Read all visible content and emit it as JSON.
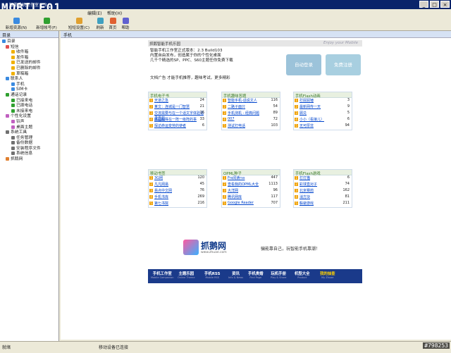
{
  "window": {
    "title": "智能手机工作室 2.3",
    "minimize": "_",
    "maximize": "□",
    "close": "×",
    "logo": "MOBILE01"
  },
  "menu": [
    "编辑(E)",
    "帮助(H)"
  ],
  "toolbar": [
    "新增资源(N)",
    "新增帐号(F)",
    "短短设置(C)",
    "刷新",
    "首页",
    "帮助"
  ],
  "sidebar": {
    "title": "目录",
    "items": [
      {
        "label": "短信",
        "level": 1,
        "color": "#e05050"
      },
      {
        "label": "收件箱",
        "level": 2,
        "color": "#f0b000"
      },
      {
        "label": "发件箱",
        "level": 2,
        "color": "#f0b000"
      },
      {
        "label": "已发送的邮件",
        "level": 2,
        "color": "#f0b000"
      },
      {
        "label": "已删除的邮件",
        "level": 2,
        "color": "#f0b000"
      },
      {
        "label": "草稿箱",
        "level": 2,
        "color": "#f0b000"
      },
      {
        "label": "联系人",
        "level": 1,
        "color": "#3a8ae0"
      },
      {
        "label": "手机",
        "level": 2,
        "color": "#3a8ae0"
      },
      {
        "label": "SIM卡",
        "level": 2,
        "color": "#3a8ae0"
      },
      {
        "label": "通话记录",
        "level": 1,
        "color": "#30a030"
      },
      {
        "label": "已接来电",
        "level": 2,
        "color": "#30a030"
      },
      {
        "label": "已拨电话",
        "level": 2,
        "color": "#30a030"
      },
      {
        "label": "未接来电",
        "level": 2,
        "color": "#30a030"
      },
      {
        "label": "个性化设置",
        "level": 1,
        "color": "#c060c0"
      },
      {
        "label": "铃声",
        "level": 2,
        "color": "#c060c0"
      },
      {
        "label": "桌面主题",
        "level": 2,
        "color": "#c060c0"
      },
      {
        "label": "系统工具",
        "level": 1,
        "color": "#707070"
      },
      {
        "label": "任务管理",
        "level": 2,
        "color": "#707070"
      },
      {
        "label": "备份数据",
        "level": 2,
        "color": "#707070"
      },
      {
        "label": "安装程序文件",
        "level": 2,
        "color": "#707070"
      },
      {
        "label": "系统信息",
        "level": 2,
        "color": "#707070"
      },
      {
        "label": "抓鹅网",
        "level": 1,
        "color": "#e08030"
      }
    ]
  },
  "content_tab": "手机",
  "header": {
    "bar_title": "抓鹅智能手机乐园",
    "slogan": "Enjoy your Mobile",
    "lines": [
      "智能手机工作室正式版本：2.3 Build103",
      "内置自由发布，创造属于你的个性化桌面",
      "几千个精选的SP、PPC、S60主题任你免费下载"
    ],
    "btn_login": "自动登录",
    "btn_register": "免费注册",
    "share": "文档广告  才能手机推荐，趣味考试，更多精彩"
  },
  "boxes": [
    {
      "title": "手机电子书",
      "rows": [
        [
          "天道之急",
          "24"
        ],
        [
          "某文：连城是一门智慧",
          "21"
        ],
        [
          "交流需要与在一个话文字体验语录界的",
          "16"
        ],
        [
          "体验特殊在一阵一级阵的事",
          "33"
        ],
        [
          "探访命运变劳的使者",
          "6"
        ]
      ]
    },
    {
      "title": "手机趣味答题",
      "rows": [
        [
          "智能手机-话说文人",
          "116"
        ],
        [
          "二路子面只",
          "54"
        ],
        [
          "手机测机 - 经典问题",
          "89"
        ],
        [
          "007",
          "72"
        ],
        [
          "测试打电话",
          "103"
        ]
      ]
    },
    {
      "title": "手机Flash动画",
      "rows": [
        [
          "打屁屁锤",
          "3"
        ],
        [
          "最新网传一天",
          "9"
        ],
        [
          "顾兑",
          "5"
        ],
        [
          "小小（看接儿）",
          "6"
        ],
        [
          "无可厚非",
          "94"
        ]
      ]
    },
    {
      "title": "移动书签",
      "rows": [
        [
          "3G网",
          "120"
        ],
        [
          "凡凡网易",
          "45"
        ],
        [
          "易点中文网",
          "76"
        ],
        [
          "手机书库",
          "269"
        ],
        [
          "第七书院",
          "216"
        ]
      ]
    },
    {
      "title": "OPML种子",
      "rows": [
        [
          "Frs阅读rss",
          "447"
        ],
        [
          "查看我的OPML大全",
          "1113"
        ],
        [
          "大洋网",
          "96"
        ],
        [
          "腾讯网库",
          "117"
        ],
        [
          "Google Reader",
          "707"
        ]
      ]
    },
    {
      "title": "手机Flash游戏",
      "rows": [
        [
          "打打猫",
          "6"
        ],
        [
          "彩球直对子",
          "74"
        ],
        [
          "北京赛鸽",
          "162"
        ],
        [
          "消方块",
          "81"
        ],
        [
          "躲避游戏",
          "211"
        ]
      ]
    }
  ],
  "banner": {
    "brand": "抓鹅网",
    "site": "www.zhuae.com",
    "slogan": "骗能靠自己，玩智能手机靠潮！"
  },
  "footer": [
    {
      "cn": "手机工作室",
      "en": "Mobile Companion"
    },
    {
      "cn": "主题乐园",
      "en": "Online Theme"
    },
    {
      "cn": "手机RSS",
      "en": "Mobile RSS"
    },
    {
      "cn": "资讯",
      "en": "Info & News"
    },
    {
      "cn": "手机贵婚",
      "en": "Find Page"
    },
    {
      "cn": "玩机手册",
      "en": "Play & Share"
    },
    {
      "cn": "机型大全",
      "en": "Product"
    },
    {
      "cn": "我的抽查",
      "en": "My Zhuae"
    }
  ],
  "status": {
    "left": "就绪",
    "middle": "移动设备已连接"
  },
  "watermark": "#798253"
}
